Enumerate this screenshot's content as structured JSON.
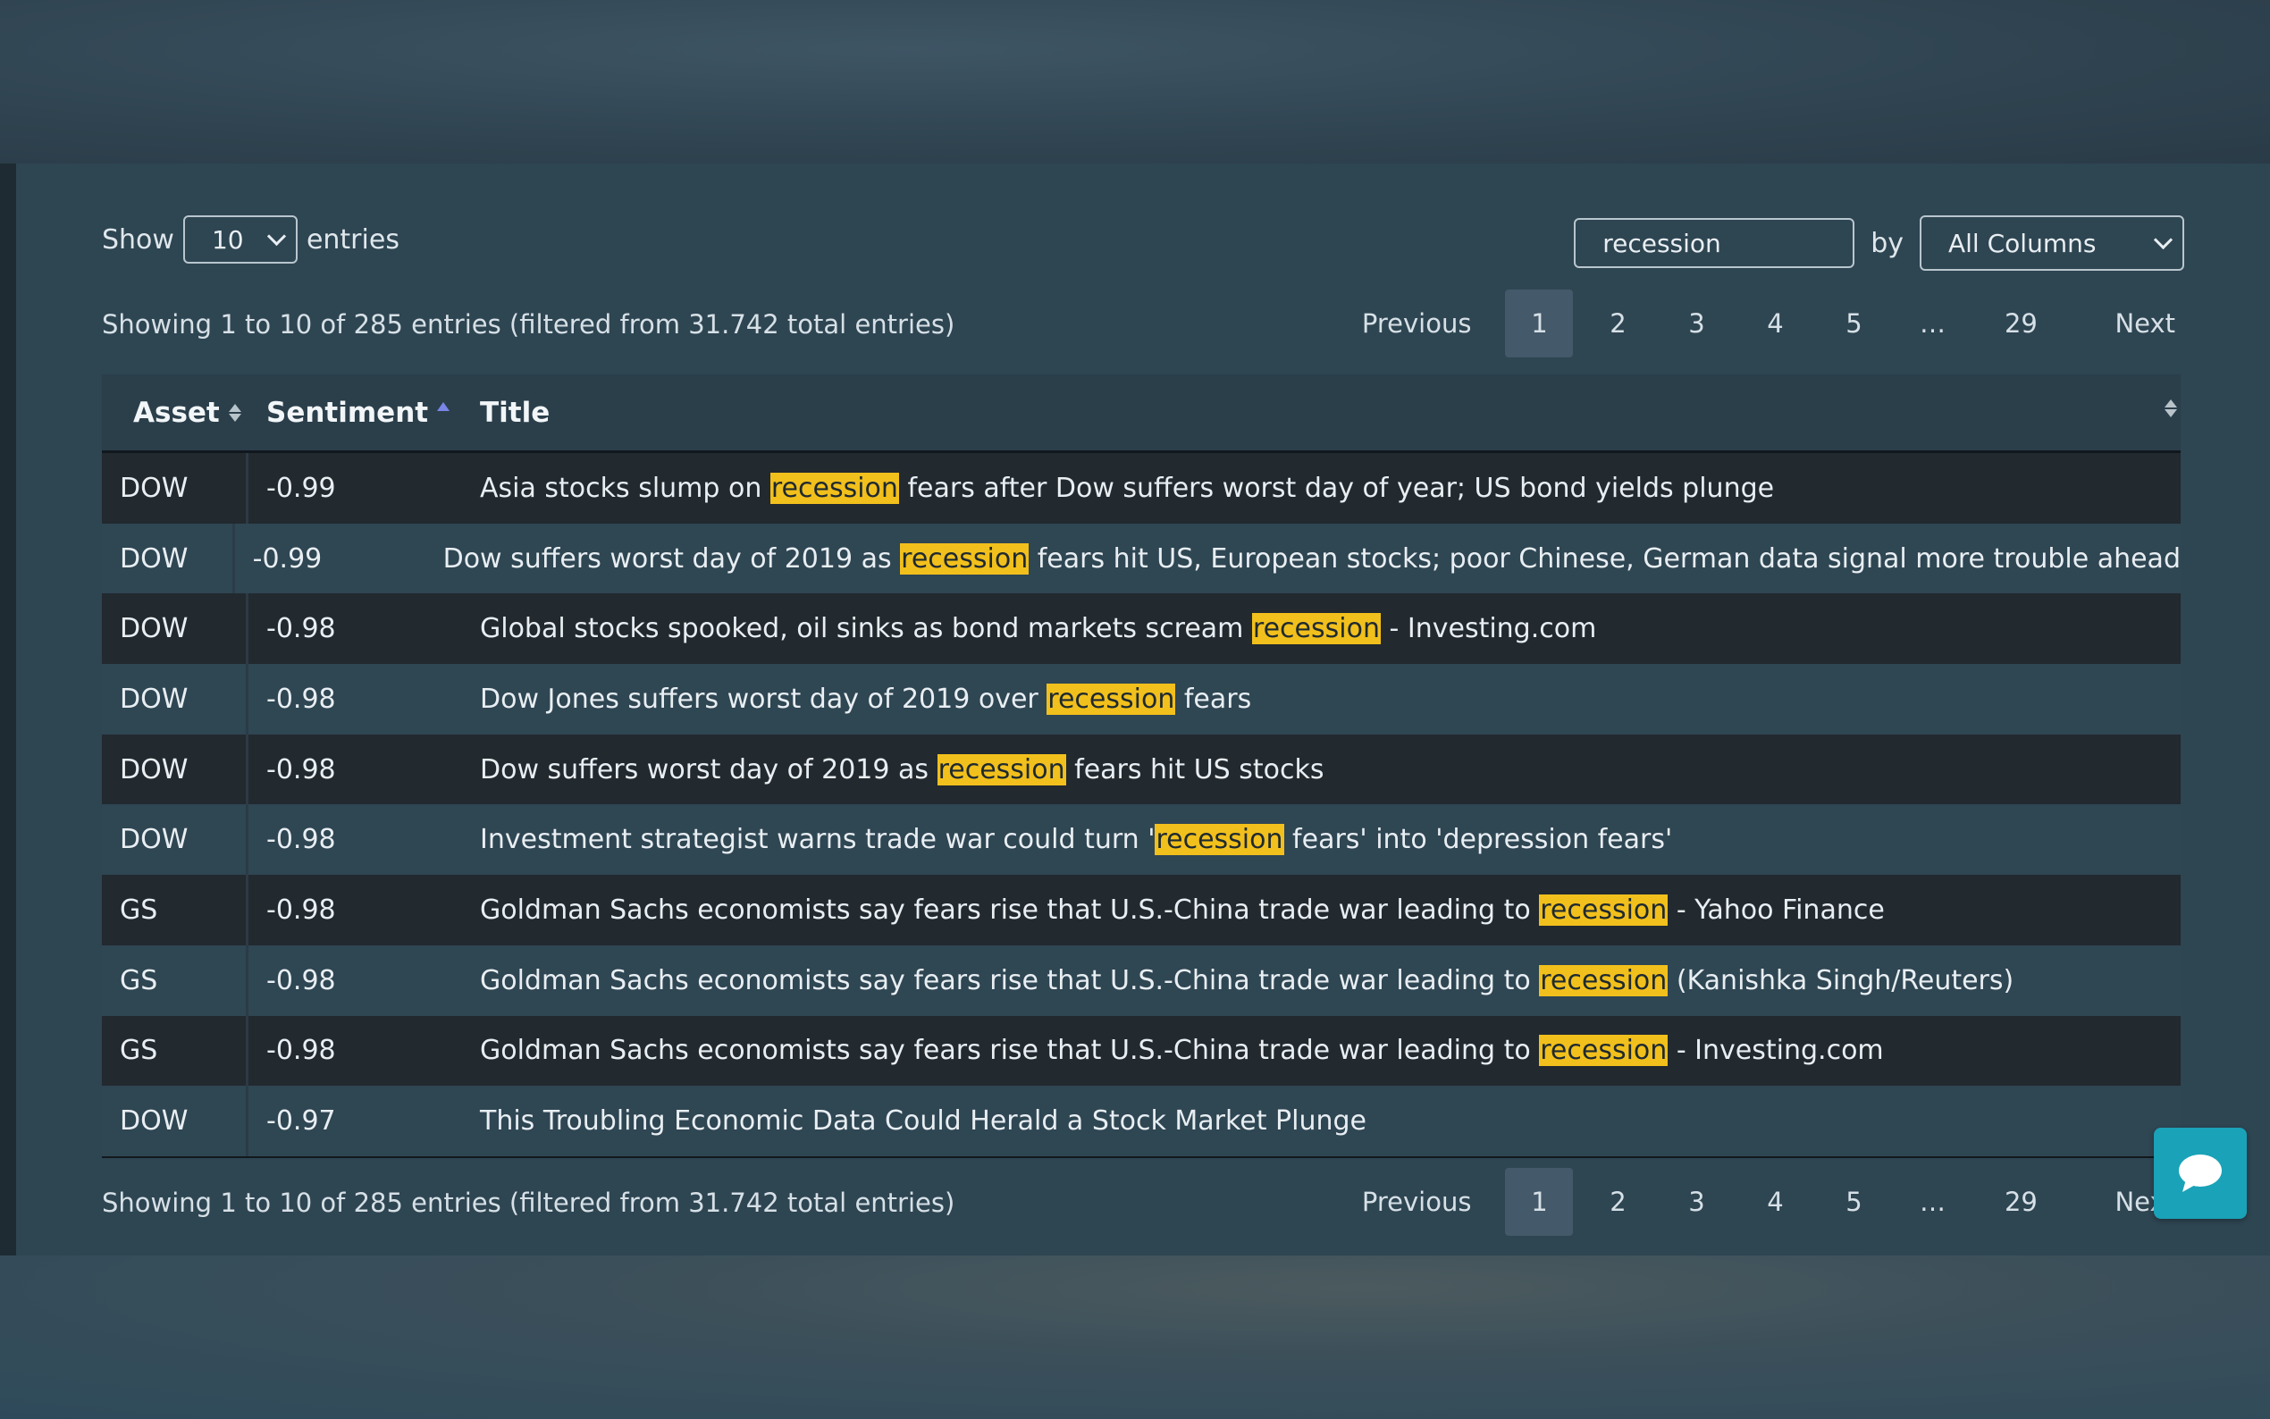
{
  "length_menu": {
    "prefix": "Show",
    "value": "10",
    "suffix": "entries"
  },
  "search": {
    "value": "recession",
    "by_label": "by",
    "scope": "All Columns"
  },
  "info_text": "Showing 1 to 10 of 285 entries (filtered from 31.742 total entries)",
  "pagination": {
    "previous": "Previous",
    "pages": [
      "1",
      "2",
      "3",
      "4",
      "5",
      "…",
      "29"
    ],
    "current": "1",
    "next": "Next"
  },
  "columns": {
    "asset": "Asset",
    "sentiment": "Sentiment",
    "title": "Title"
  },
  "highlight_color": "#f2c01c",
  "rows": [
    {
      "asset": "DOW",
      "sentiment": "-0.99",
      "pre": "Asia stocks slump on ",
      "hl": "recession",
      "post": " fears after Dow suffers worst day of year; US bond yields plunge"
    },
    {
      "asset": "DOW",
      "sentiment": "-0.99",
      "pre": "Dow suffers worst day of 2019 as ",
      "hl": "recession",
      "post": " fears hit US, European stocks; poor Chinese, German data signal more trouble ahead"
    },
    {
      "asset": "DOW",
      "sentiment": "-0.98",
      "pre": "Global stocks spooked, oil sinks as bond markets scream ",
      "hl": "recession",
      "post": " - Investing.com"
    },
    {
      "asset": "DOW",
      "sentiment": "-0.98",
      "pre": "Dow Jones suffers worst day of 2019 over ",
      "hl": "recession",
      "post": " fears"
    },
    {
      "asset": "DOW",
      "sentiment": "-0.98",
      "pre": "Dow suffers worst day of 2019 as ",
      "hl": "recession",
      "post": " fears hit US stocks"
    },
    {
      "asset": "DOW",
      "sentiment": "-0.98",
      "pre": "Investment strategist warns trade war could turn '",
      "hl": "recession",
      "post": " fears' into 'depression fears'"
    },
    {
      "asset": "GS",
      "sentiment": "-0.98",
      "pre": "Goldman Sachs economists say fears rise that U.S.-China trade war leading to ",
      "hl": "recession",
      "post": " - Yahoo Finance"
    },
    {
      "asset": "GS",
      "sentiment": "-0.98",
      "pre": "Goldman Sachs economists say fears rise that U.S.-China trade war leading to ",
      "hl": "recession",
      "post": " (Kanishka Singh/Reuters)"
    },
    {
      "asset": "GS",
      "sentiment": "-0.98",
      "pre": "Goldman Sachs economists say fears rise that U.S.-China trade war leading to ",
      "hl": "recession",
      "post": " - Investing.com"
    },
    {
      "asset": "DOW",
      "sentiment": "-0.97",
      "pre": "This Troubling Economic Data Could Herald a Stock Market Plunge",
      "hl": "",
      "post": ""
    }
  ],
  "chat_icon": "chat-bubble-icon"
}
